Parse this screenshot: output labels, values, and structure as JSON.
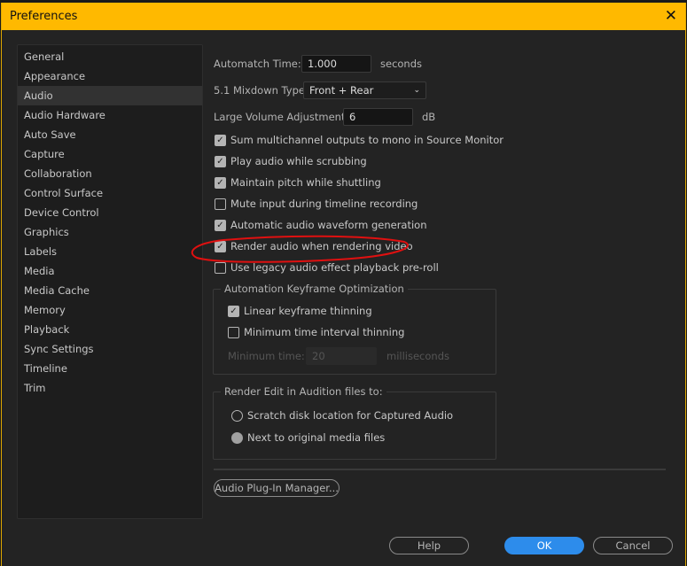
{
  "title": "Preferences",
  "sidebar": {
    "items": [
      "General",
      "Appearance",
      "Audio",
      "Audio Hardware",
      "Auto Save",
      "Capture",
      "Collaboration",
      "Control Surface",
      "Device Control",
      "Graphics",
      "Labels",
      "Media",
      "Media Cache",
      "Memory",
      "Playback",
      "Sync Settings",
      "Timeline",
      "Trim"
    ],
    "selected": "Audio"
  },
  "fields": {
    "automatch_label": "Automatch Time:",
    "automatch_value": "1.000",
    "automatch_unit": "seconds",
    "mixdown_label": "5.1 Mixdown Type:",
    "mixdown_value": "Front + Rear",
    "volume_label": "Large Volume Adjustment:",
    "volume_value": "6",
    "volume_unit": "dB"
  },
  "checkboxes": [
    {
      "label": "Sum multichannel outputs to mono in Source Monitor",
      "checked": true
    },
    {
      "label": "Play audio while scrubbing",
      "checked": true
    },
    {
      "label": "Maintain pitch while shuttling",
      "checked": true
    },
    {
      "label": "Mute input during timeline recording",
      "checked": false
    },
    {
      "label": "Automatic audio waveform generation",
      "checked": true
    },
    {
      "label": "Render audio when rendering video",
      "checked": true
    },
    {
      "label": "Use legacy audio effect playback pre-roll",
      "checked": false
    }
  ],
  "automation": {
    "legend": "Automation Keyframe Optimization",
    "linear": "Linear keyframe thinning",
    "linear_checked": true,
    "minimum": "Minimum time interval thinning",
    "minimum_checked": false,
    "min_time_label": "Minimum time:",
    "min_time_value": "20",
    "min_time_unit": "milliseconds"
  },
  "render_edit": {
    "legend": "Render Edit in Audition files to:",
    "options": [
      "Scratch disk location for Captured Audio",
      "Next to original media files"
    ],
    "selected": 1
  },
  "buttons": {
    "plugin_manager": "Audio Plug-In Manager...",
    "help": "Help",
    "ok": "OK",
    "cancel": "Cancel"
  },
  "colors": {
    "titlebar": "#ffb900",
    "ok": "#2d8ceb",
    "annotation": "#e01010"
  }
}
